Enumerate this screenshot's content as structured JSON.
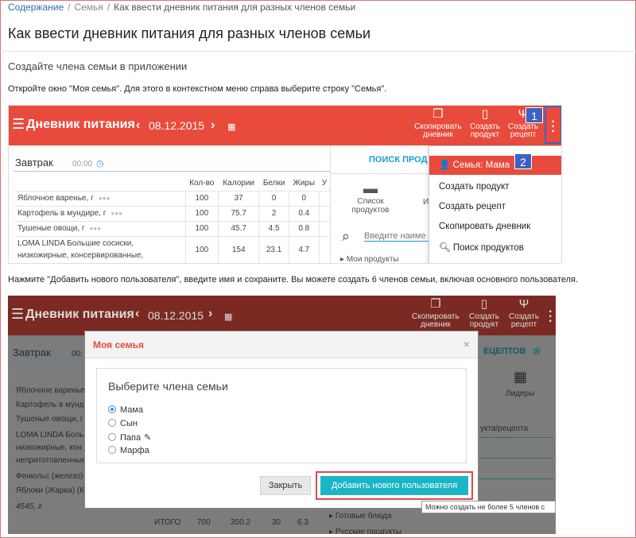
{
  "breadcrumb": {
    "root": "Содержание",
    "section": "Семья",
    "current": "Как ввести дневник питания для разных членов семьи"
  },
  "page_title": "Как ввести дневник питания для разных членов семьи",
  "section_heading": "Создайте члена семьи в приложении",
  "instruction_1": "Откройте окно \"Моя семья\". Для этого в контекстном меню справа выберите строку \"Семья\".",
  "instruction_2": "Нажмите \"Добавить нового пользователя\", введите имя и сохраните. Вы можете создать 6 членов семьи, включая основного пользователя.",
  "screenshot_1": {
    "app_title": "Дневник питания",
    "date": "08.12.2015",
    "toolbar": [
      {
        "line1": "Скопировать",
        "line2": "дневник",
        "icon": "copy-icon"
      },
      {
        "line1": "Создать",
        "line2": "продукт",
        "icon": "document-icon"
      },
      {
        "line1": "Создать",
        "line2": "рецепт",
        "icon": "fork-knife-icon"
      }
    ],
    "callouts": [
      "1",
      "2"
    ],
    "meal": "Завтрак",
    "meal_time": "00:00",
    "columns": [
      "Кол-во",
      "Калории",
      "Белки",
      "Жиры",
      "У"
    ],
    "rows": [
      {
        "name": "Яблочное варенье, г",
        "name2": "",
        "values": [
          "100",
          "37",
          "0",
          "0"
        ]
      },
      {
        "name": "Картофель в мундире, г",
        "name2": "",
        "values": [
          "100",
          "75.7",
          "2",
          "0.4"
        ]
      },
      {
        "name": "Тушеные овощи, г",
        "name2": "",
        "values": [
          "100",
          "45.7",
          "4.5",
          "0.8"
        ]
      },
      {
        "name": "LOMA LINDA Большие сосиски,",
        "name2": "низкожирные, консервированные,",
        "values": [
          "100",
          "154",
          "23.1",
          "4.7"
        ]
      }
    ],
    "panel_tab": "ПОИСК ПРОД",
    "product_list": [
      "Список",
      "продуктов"
    ],
    "panel_col2_letter": "И",
    "search_placeholder": "Введите наиме",
    "my_products": "Мои продукты",
    "menu": {
      "selected": "Семья: Мама",
      "items": [
        "Создать продукт",
        "Создать рецепт",
        "Скопировать дневник",
        "Поиск продуктов"
      ]
    }
  },
  "screenshot_2": {
    "app_title": "Дневник питания",
    "date": "08.12.2015",
    "toolbar": [
      {
        "line1": "Скопировать",
        "line2": "дневник"
      },
      {
        "line1": "Создать",
        "line2": "продукт"
      },
      {
        "line1": "Создать",
        "line2": "рецепт"
      }
    ],
    "meal": "Завтрак",
    "meal_time_partial": "00:",
    "bg_rows": [
      "Яблочное варенье",
      "Картофель в мунд",
      "Тушеные овощи, г",
      "LOMA LINDA Боль",
      "низкожирные, кон",
      "непритотовленные",
      "Фенюльс (железо)",
      "Яблоки (Жарка) (К",
      "4545, г"
    ],
    "bg_total_label": "ИТОГО",
    "bg_totals": [
      "700",
      "350.2",
      "30",
      "6.3"
    ],
    "bg_panel_tab": "ЕЦЕПТОВ",
    "bg_leaders": "Лидеры",
    "bg_search_partial": "укта/рецепта",
    "bg_categories": [
      "Готовые блюда",
      "Русские продукты"
    ],
    "modal": {
      "title": "Моя семья",
      "close": "×",
      "prompt": "Выберите члена семьи",
      "members": [
        {
          "name": "Мама",
          "selected": true,
          "editable": false
        },
        {
          "name": "Сын",
          "selected": false,
          "editable": false
        },
        {
          "name": "Папа",
          "selected": false,
          "editable": true
        },
        {
          "name": "Марфа",
          "selected": false,
          "editable": false
        }
      ],
      "close_button": "Закрыть",
      "add_button": "Добавить нового пользователя"
    },
    "tooltip": "Можно создать не более 5 членов с"
  },
  "colors": {
    "accent_red": "#e84b3c",
    "teal_button": "#1ab5c6",
    "link_blue": "#2a6ebb",
    "callout_blue": "#3d62c4",
    "highlight_red": "#e04848"
  }
}
